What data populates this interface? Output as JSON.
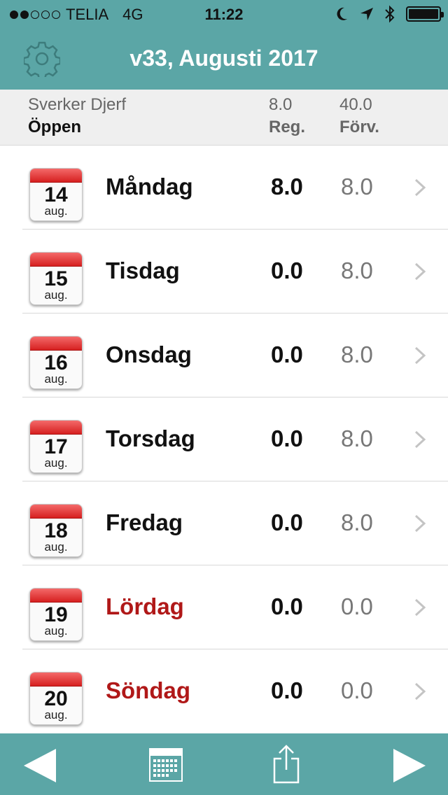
{
  "status_bar": {
    "carrier": "TELIA",
    "network": "4G",
    "time": "11:22",
    "signal_bars": 2,
    "signal_total": 5
  },
  "header": {
    "title": "v33, Augusti 2017",
    "settings_icon": "gear-icon"
  },
  "summary": {
    "name": "Sverker Djerf",
    "status": "Öppen",
    "reg_value": "8.0",
    "reg_label": "Reg.",
    "forv_value": "40.0",
    "forv_label": "Förv."
  },
  "days": [
    {
      "date": "14",
      "month": "aug.",
      "name": "Måndag",
      "reg": "8.0",
      "forv": "8.0",
      "weekend": false
    },
    {
      "date": "15",
      "month": "aug.",
      "name": "Tisdag",
      "reg": "0.0",
      "forv": "8.0",
      "weekend": false
    },
    {
      "date": "16",
      "month": "aug.",
      "name": "Onsdag",
      "reg": "0.0",
      "forv": "8.0",
      "weekend": false
    },
    {
      "date": "17",
      "month": "aug.",
      "name": "Torsdag",
      "reg": "0.0",
      "forv": "8.0",
      "weekend": false
    },
    {
      "date": "18",
      "month": "aug.",
      "name": "Fredag",
      "reg": "0.0",
      "forv": "8.0",
      "weekend": false
    },
    {
      "date": "19",
      "month": "aug.",
      "name": "Lördag",
      "reg": "0.0",
      "forv": "0.0",
      "weekend": true
    },
    {
      "date": "20",
      "month": "aug.",
      "name": "Söndag",
      "reg": "0.0",
      "forv": "0.0",
      "weekend": true
    }
  ],
  "toolbar": {
    "items": [
      "previous-week-icon",
      "calendar-icon",
      "share-icon",
      "next-week-icon"
    ]
  },
  "colors": {
    "accent": "#5ba6a6",
    "weekend": "#b01818",
    "calendar_band": "#d62020"
  }
}
